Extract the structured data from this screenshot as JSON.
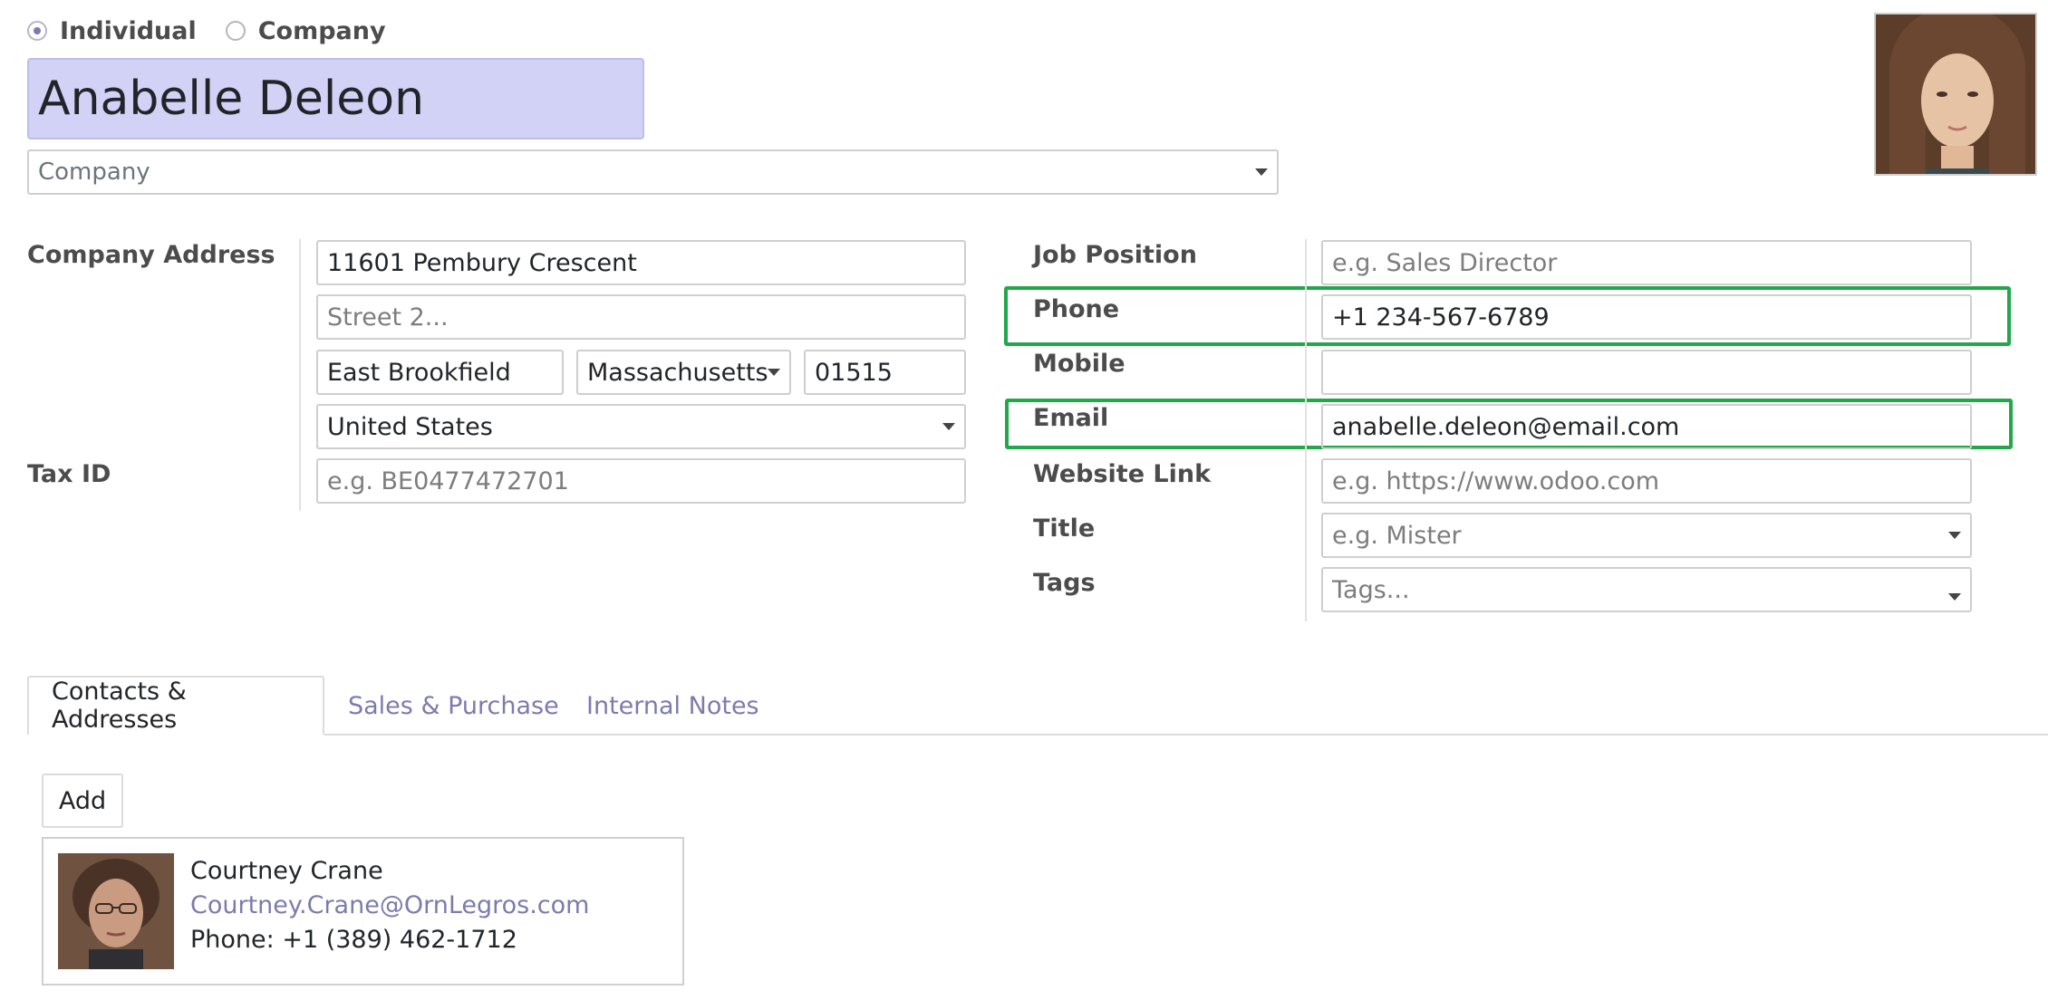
{
  "partner_type": {
    "individual_label": "Individual",
    "company_label": "Company",
    "selected": "Individual"
  },
  "name": "Anabelle Deleon",
  "company_field": {
    "placeholder": "Company"
  },
  "address": {
    "label": "Company Address",
    "street": "11601 Pembury Crescent",
    "street2_placeholder": "Street 2...",
    "city": "East Brookfield",
    "state": "Massachusetts",
    "zip": "01515",
    "country": "United States"
  },
  "tax": {
    "label": "Tax ID",
    "placeholder": "e.g. BE0477472701"
  },
  "right_fields": {
    "job_position": {
      "label": "Job Position",
      "placeholder": "e.g. Sales Director"
    },
    "phone": {
      "label": "Phone",
      "value": "+1 234-567-6789"
    },
    "mobile": {
      "label": "Mobile",
      "value": ""
    },
    "email": {
      "label": "Email",
      "value": "anabelle.deleon@email.com"
    },
    "website": {
      "label": "Website Link",
      "placeholder": "e.g. https://www.odoo.com"
    },
    "title": {
      "label": "Title",
      "placeholder": "e.g. Mister"
    },
    "tags": {
      "label": "Tags",
      "placeholder": "Tags..."
    }
  },
  "tabs": [
    {
      "label": "Contacts & Addresses",
      "active": true
    },
    {
      "label": "Sales & Purchase",
      "active": false
    },
    {
      "label": "Internal Notes",
      "active": false
    }
  ],
  "contacts": {
    "add_label": "Add",
    "items": [
      {
        "name": "Courtney Crane",
        "email": "Courtney.Crane@OrnLegros.com",
        "phone": "Phone: +1 (389) 462-1712"
      }
    ]
  },
  "colors": {
    "accent": "#7c7bad",
    "highlight": "#22a84a",
    "name_bg": "#d2d2f7"
  },
  "icons": {
    "avatar": "avatar",
    "dropdown": "caret-down-icon"
  }
}
